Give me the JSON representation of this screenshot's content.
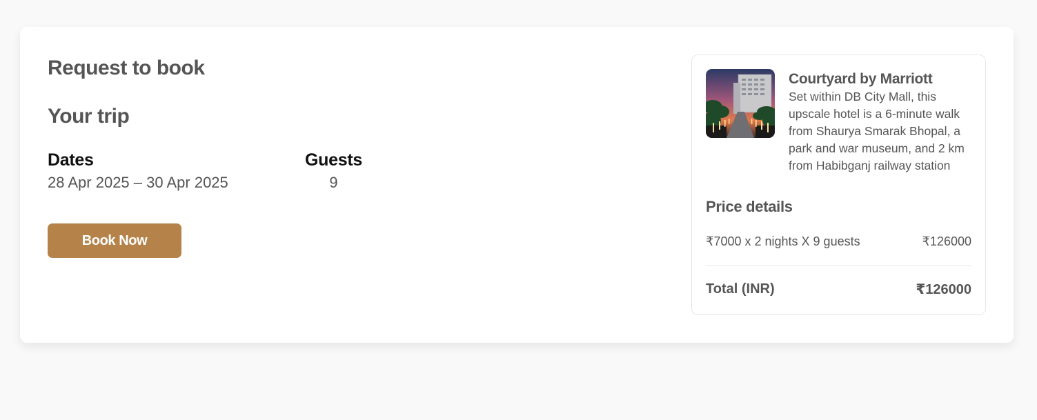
{
  "booking": {
    "title": "Request to book",
    "trip_heading": "Your trip",
    "dates_label": "Dates",
    "dates_value": "28 Apr 2025 – 30 Apr 2025",
    "guests_label": "Guests",
    "guests_value": "9",
    "book_button_label": "Book Now"
  },
  "summary": {
    "hotel_name": "Courtyard by Marriott",
    "hotel_description": "Set within DB City Mall, this upscale hotel is a 6-minute walk from Shaurya Smarak Bhopal, a park and war museum, and 2 km from Habibganj railway station",
    "price_details_heading": "Price details",
    "price_line_label": "₹7000 x 2 nights X 9 guests",
    "price_line_amount": "₹126000",
    "total_label": "Total (INR)",
    "total_amount": "₹126000"
  },
  "colors": {
    "accent": "#b5834a",
    "text_muted": "#555555",
    "text_strong": "#111111",
    "page_background": "#f9f9f9"
  }
}
